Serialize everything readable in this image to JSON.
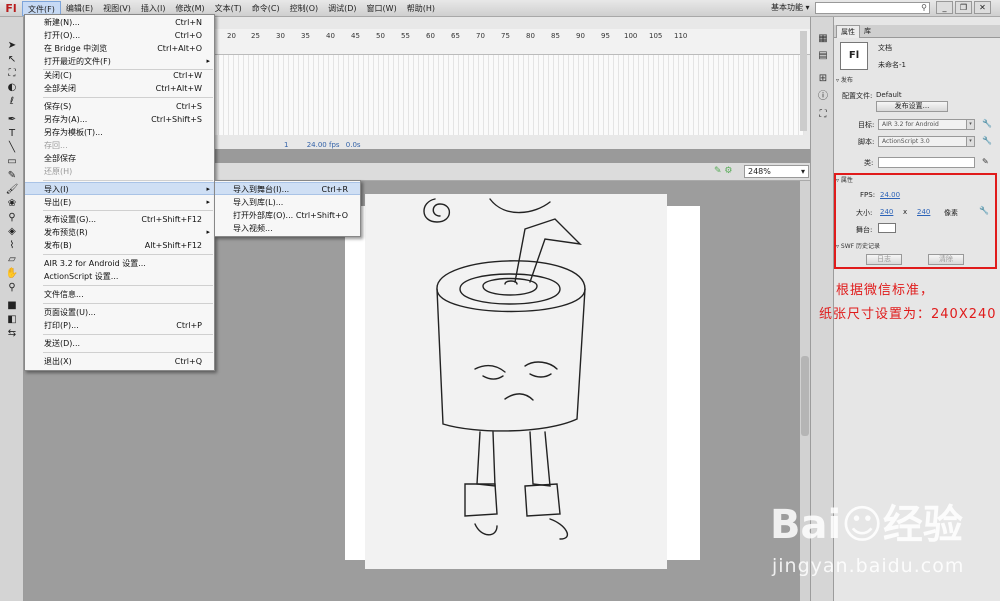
{
  "app": {
    "logo": "Fl",
    "menus": [
      "文件(F)",
      "编辑(E)",
      "视图(V)",
      "插入(I)",
      "修改(M)",
      "文本(T)",
      "命令(C)",
      "控制(O)",
      "调试(D)",
      "窗口(W)",
      "帮助(H)"
    ],
    "workspace": "基本功能 ▾",
    "window_buttons": [
      "_",
      "❐",
      "✕"
    ]
  },
  "timeline": {
    "ruler_ticks": [
      "20",
      "25",
      "30",
      "35",
      "40",
      "45",
      "50",
      "55",
      "60",
      "65",
      "70",
      "75",
      "80",
      "85",
      "90",
      "95",
      "100",
      "105",
      "110"
    ],
    "frame": "1",
    "fps": "24.00",
    "fps_unit": "fps",
    "time": "0.0s"
  },
  "stage": {
    "zoom": "248%"
  },
  "file_menu": {
    "items": [
      {
        "label": "新建(N)...",
        "shortcut": "Ctrl+N"
      },
      {
        "label": "打开(O)...",
        "shortcut": "Ctrl+O"
      },
      {
        "label": "在 Bridge 中浏览",
        "shortcut": "Ctrl+Alt+O"
      },
      {
        "label": "打开最近的文件(F)",
        "shortcut": "▸"
      },
      {
        "label": "关闭(C)",
        "shortcut": "Ctrl+W"
      },
      {
        "label": "全部关闭",
        "shortcut": "Ctrl+Alt+W"
      },
      {
        "label": "保存(S)",
        "shortcut": "Ctrl+S"
      },
      {
        "label": "另存为(A)...",
        "shortcut": "Ctrl+Shift+S"
      },
      {
        "label": "另存为模板(T)...",
        "shortcut": ""
      },
      {
        "label": "存回...",
        "shortcut": ""
      },
      {
        "label": "全部保存",
        "shortcut": ""
      },
      {
        "label": "还原(H)",
        "shortcut": ""
      },
      {
        "label": "导入(I)",
        "shortcut": "▸"
      },
      {
        "label": "导出(E)",
        "shortcut": "▸"
      },
      {
        "label": "发布设置(G)...",
        "shortcut": "Ctrl+Shift+F12"
      },
      {
        "label": "发布预览(R)",
        "shortcut": "▸"
      },
      {
        "label": "发布(B)",
        "shortcut": "Alt+Shift+F12"
      },
      {
        "label": "AIR 3.2 for Android 设置...",
        "shortcut": ""
      },
      {
        "label": "ActionScript 设置...",
        "shortcut": ""
      },
      {
        "label": "文件信息...",
        "shortcut": ""
      },
      {
        "label": "页面设置(U)...",
        "shortcut": ""
      },
      {
        "label": "打印(P)...",
        "shortcut": "Ctrl+P"
      },
      {
        "label": "发送(D)...",
        "shortcut": ""
      },
      {
        "label": "退出(X)",
        "shortcut": "Ctrl+Q"
      }
    ]
  },
  "import_menu": {
    "items": [
      {
        "label": "导入到舞台(I)...",
        "shortcut": "Ctrl+R"
      },
      {
        "label": "导入到库(L)...",
        "shortcut": ""
      },
      {
        "label": "打开外部库(O)...",
        "shortcut": "Ctrl+Shift+O"
      },
      {
        "label": "导入视频...",
        "shortcut": ""
      }
    ]
  },
  "properties": {
    "tabs": [
      "属性",
      "库"
    ],
    "doc_icon": "Fl",
    "doc_type": "文档",
    "doc_name": "未命名-1",
    "publish_section": "发布",
    "profile_label": "配置文件:",
    "profile_value": "Default",
    "publish_settings_button": "发布设置...",
    "target_label": "目标:",
    "target_value": "AIR 3.2 for Android",
    "script_label": "脚本:",
    "script_value": "ActionScript 3.0",
    "class_label": "类:",
    "props_section": "属性",
    "fps_label": "FPS:",
    "fps_value": "24.00",
    "size_label": "大小:",
    "width": "240",
    "x": "x",
    "height": "240",
    "unit": "像素",
    "stage_label": "舞台:",
    "swf_section": "SWF 历史记录",
    "log_button": "日志",
    "clear_button": "清除"
  },
  "annotation": {
    "line1": "根据微信标准，",
    "line2": "纸张尺寸设置为：240X240",
    "color": "#e01b1b"
  },
  "watermark": {
    "logo": "Bai☺经验",
    "url": "jingyan.baidu.com"
  }
}
